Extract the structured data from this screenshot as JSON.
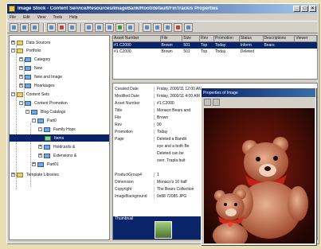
{
  "window": {
    "title": "Image Stock - Content Service/Resources/ImageBank/Root/default/FinTrack/s Properties",
    "buttons": [
      "_",
      "□",
      "×"
    ]
  },
  "menu": [
    "File",
    "Edit",
    "View",
    "Tools",
    "Help"
  ],
  "tree": {
    "items": [
      {
        "label": "Data Sources",
        "icon": "folder-icon"
      },
      {
        "label": "Portfolio",
        "icon": "folder-icon"
      },
      {
        "label": "Category",
        "icon": "folder-icon"
      },
      {
        "label": "New",
        "icon": "folder-icon"
      },
      {
        "label": "New and Image",
        "icon": "folder-icon"
      },
      {
        "label": "Hoarlauges",
        "icon": "folder-icon"
      },
      {
        "label": "Content Sets",
        "icon": "folder-icon"
      },
      {
        "label": "Content Promotion",
        "icon": "folder-icon"
      },
      {
        "label": "Blog Catalogs",
        "icon": "folder-icon"
      },
      {
        "label": "Part0",
        "icon": "folder-icon"
      },
      {
        "label": "Family Hops",
        "icon": "folder-icon"
      },
      {
        "label": "Items",
        "icon": "folder-icon"
      },
      {
        "label": "Holdcards &",
        "icon": "folder-icon"
      },
      {
        "label": "Extensions &",
        "icon": "folder-icon"
      },
      {
        "label": "Part01",
        "icon": "folder-icon"
      },
      {
        "label": "Template Libraries",
        "icon": "folder-icon"
      }
    ]
  },
  "grid": {
    "headers": [
      "Asset Number",
      "File",
      "Size",
      "Rev",
      "Promotion",
      "Status",
      "Descriptions",
      "Viewer"
    ],
    "rows": [
      [
        "#1 C2000",
        "Brown",
        "501",
        "Top",
        "Today",
        "Inform",
        "Bears",
        ""
      ],
      [
        "#1 C2000",
        "Brown",
        "501",
        "Top",
        "Today",
        "Deleted",
        "",
        ""
      ]
    ]
  },
  "props": {
    "rows": [
      {
        "k": "Created Date",
        "v": "Friday, 2000/11 12:00 AM"
      },
      {
        "k": "Modified Date",
        "v": "Friday, 2000/11 4:00 AM"
      },
      {
        "k": "Asset Number",
        "v": "#1 C2000"
      },
      {
        "k": "Title",
        "v": "Monaco Bears and"
      },
      {
        "k": "File",
        "v": "Brown"
      },
      {
        "k": "Rev",
        "v": "90"
      },
      {
        "k": "Promotion",
        "v": "Today"
      },
      {
        "k": "Page",
        "v": "Deleted a Bandit"
      },
      {
        "k": "",
        "v": "eye and a both Be"
      },
      {
        "k": "",
        "v": "Deleted can be"
      },
      {
        "k": "",
        "v": "over. Trapla buit"
      },
      {
        "k": "",
        "v": ""
      },
      {
        "k": "ProductGroup4",
        "v": "1"
      },
      {
        "k": "Dimension",
        "v": "Monaco's 10 half"
      },
      {
        "k": "Copyright",
        "v": "The Bears Collection"
      },
      {
        "k": "ImageBackground",
        "v": "0x88 72085 JPG"
      }
    ],
    "thumbnail_label": "Thumbnail"
  },
  "viewer": {
    "title": "Properties of Image"
  }
}
